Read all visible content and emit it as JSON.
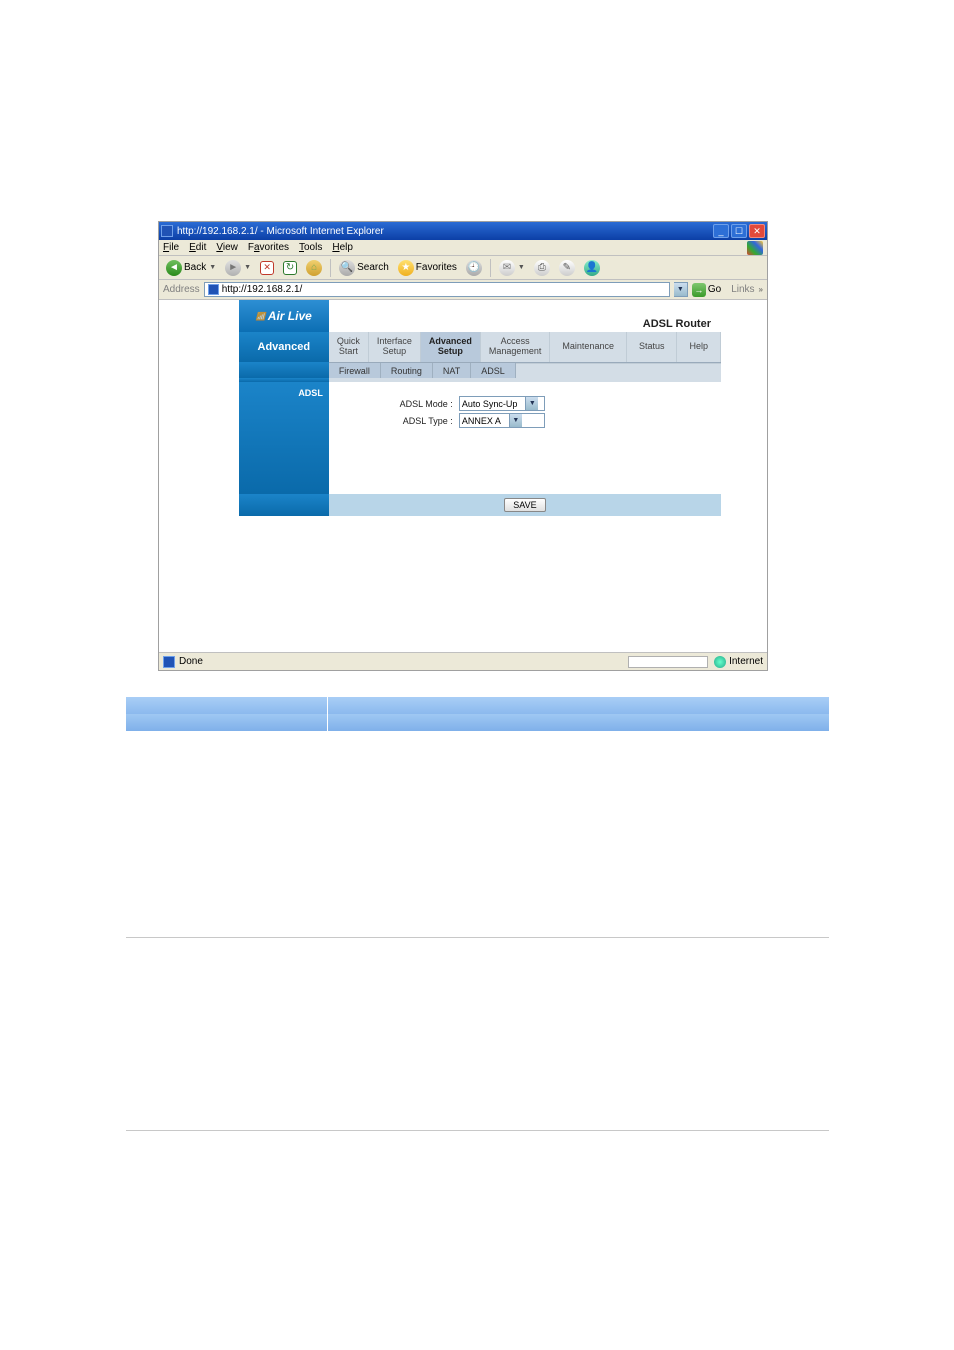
{
  "window": {
    "title": "http://192.168.2.1/ - Microsoft Internet Explorer"
  },
  "menubar": {
    "items": [
      "File",
      "Edit",
      "View",
      "Favorites",
      "Tools",
      "Help"
    ]
  },
  "toolbar": {
    "back": "Back",
    "search": "Search",
    "favorites": "Favorites"
  },
  "addressbar": {
    "label": "Address",
    "url": "http://192.168.2.1/",
    "go": "Go",
    "links": "Links"
  },
  "router": {
    "logo": "Air Live",
    "product_title": "ADSL Router",
    "section": "Advanced",
    "tabs": {
      "quick_start_l1": "Quick",
      "quick_start_l2": "Start",
      "interface_setup_l1": "Interface",
      "interface_setup_l2": "Setup",
      "advanced_setup_l1": "Advanced",
      "advanced_setup_l2": "Setup",
      "access_mgmt_l1": "Access",
      "access_mgmt_l2": "Management",
      "maintenance": "Maintenance",
      "status": "Status",
      "help": "Help"
    },
    "subtabs": {
      "firewall": "Firewall",
      "routing": "Routing",
      "nat": "NAT",
      "adsl": "ADSL"
    },
    "body_title": "ADSL",
    "form": {
      "mode_label": "ADSL Mode :",
      "mode_value": "Auto Sync-Up",
      "type_label": "ADSL Type :",
      "type_value": "ANNEX A"
    },
    "save_button": "SAVE"
  },
  "statusbar": {
    "text": "Done",
    "zone": "Internet"
  }
}
